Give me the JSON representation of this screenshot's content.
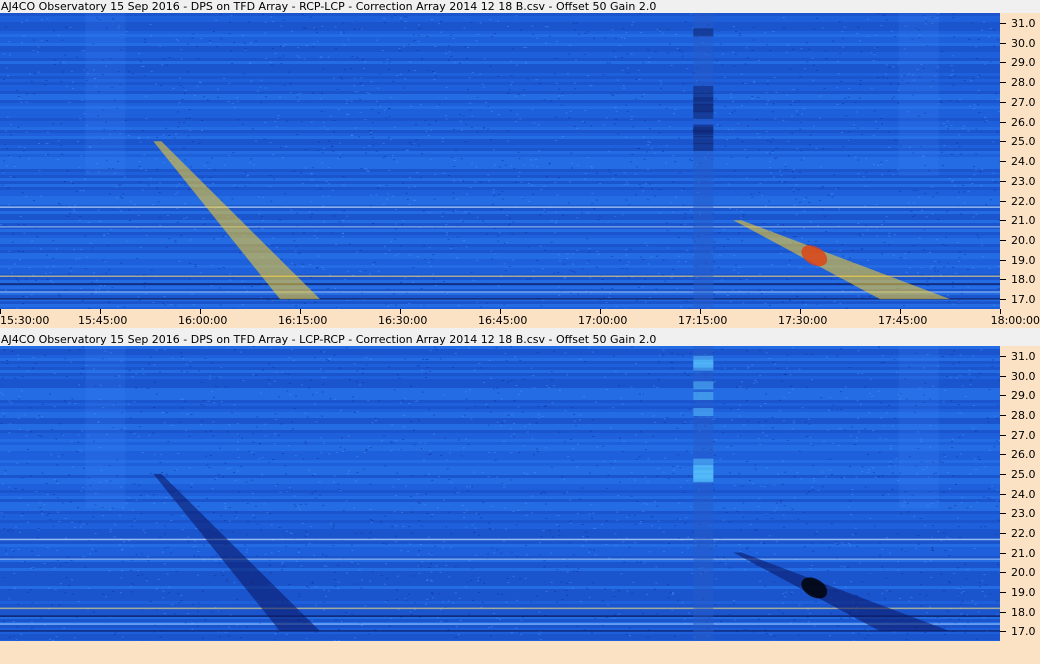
{
  "panels": [
    {
      "title": "AJ4CO Observatory 15 Sep 2016  -  DPS on TFD Array  -  RCP-LCP  -  Correction Array 2014 12 18 B.csv  -  Offset 50  Gain 2.0",
      "polarity": "RCP-LCP",
      "burst_color": "#ffd020",
      "burst_core_color": "#e04010",
      "base_color": "#1f63e0"
    },
    {
      "title": "AJ4CO Observatory 15 Sep 2016  -  DPS on TFD Array  -  LCP-RCP  -  Correction Array 2014 12 18 B.csv  -  Offset 50  Gain 2.0",
      "polarity": "LCP-RCP",
      "burst_color": "#0b1a6a",
      "burst_core_color": "#000000",
      "base_color": "#1f63e0"
    }
  ],
  "y_ticks": [
    "31.0",
    "30.0",
    "29.0",
    "28.0",
    "27.0",
    "26.0",
    "25.0",
    "24.0",
    "23.0",
    "22.0",
    "21.0",
    "20.0",
    "19.0",
    "18.0",
    "17.0"
  ],
  "x_ticks": [
    "15:30:00",
    "15:45:00",
    "16:00:00",
    "16:15:00",
    "16:30:00",
    "16:45:00",
    "17:00:00",
    "17:15:00",
    "17:30:00",
    "17:45:00",
    "18:00:00"
  ],
  "chart_data": [
    {
      "type": "heatmap",
      "title": "AJ4CO Observatory 15 Sep 2016  -  DPS on TFD Array  -  RCP-LCP  -  Correction Array 2014 12 18 B.csv  -  Offset 50  Gain 2.0",
      "xlabel": "",
      "ylabel": "",
      "x_range": [
        "15:30:00",
        "18:00:00"
      ],
      "y_range": [
        16.5,
        31.5
      ],
      "y_ticks": [
        31.0,
        30.0,
        29.0,
        28.0,
        27.0,
        26.0,
        25.0,
        24.0,
        23.0,
        22.0,
        21.0,
        20.0,
        19.0,
        18.0,
        17.0
      ],
      "x_ticks": [
        "15:30:00",
        "15:45:00",
        "16:00:00",
        "16:15:00",
        "16:30:00",
        "16:45:00",
        "17:00:00",
        "17:15:00",
        "17:30:00",
        "17:45:00",
        "18:00:00"
      ],
      "features": [
        {
          "kind": "drifting burst",
          "start_time": "15:53:00",
          "end_time": "16:12:00",
          "freq_start": 25.0,
          "freq_end": 17.0,
          "intensity": "high"
        },
        {
          "kind": "drifting burst",
          "start_time": "17:20:00",
          "end_time": "17:42:00",
          "freq_start": 21.0,
          "freq_end": 17.0,
          "intensity": "very high"
        },
        {
          "kind": "broadband interference column",
          "start_time": "17:14:00",
          "end_time": "17:17:00"
        }
      ]
    },
    {
      "type": "heatmap",
      "title": "AJ4CO Observatory 15 Sep 2016  -  DPS on TFD Array  -  LCP-RCP  -  Correction Array 2014 12 18 B.csv  -  Offset 50  Gain 2.0",
      "xlabel": "",
      "ylabel": "",
      "x_range": [
        "15:30:00",
        "18:00:00"
      ],
      "y_range": [
        16.5,
        31.5
      ],
      "y_ticks": [
        31.0,
        30.0,
        29.0,
        28.0,
        27.0,
        26.0,
        25.0,
        24.0,
        23.0,
        22.0,
        21.0,
        20.0,
        19.0,
        18.0,
        17.0
      ],
      "features": [
        {
          "kind": "drifting burst (inverted)",
          "start_time": "15:53:00",
          "end_time": "16:12:00",
          "freq_start": 25.0,
          "freq_end": 17.0,
          "intensity": "low"
        },
        {
          "kind": "drifting burst (inverted)",
          "start_time": "17:20:00",
          "end_time": "17:42:00",
          "freq_start": 21.0,
          "freq_end": 17.0,
          "intensity": "very low"
        },
        {
          "kind": "broadband interference column",
          "start_time": "17:14:00",
          "end_time": "17:17:00"
        }
      ]
    }
  ]
}
